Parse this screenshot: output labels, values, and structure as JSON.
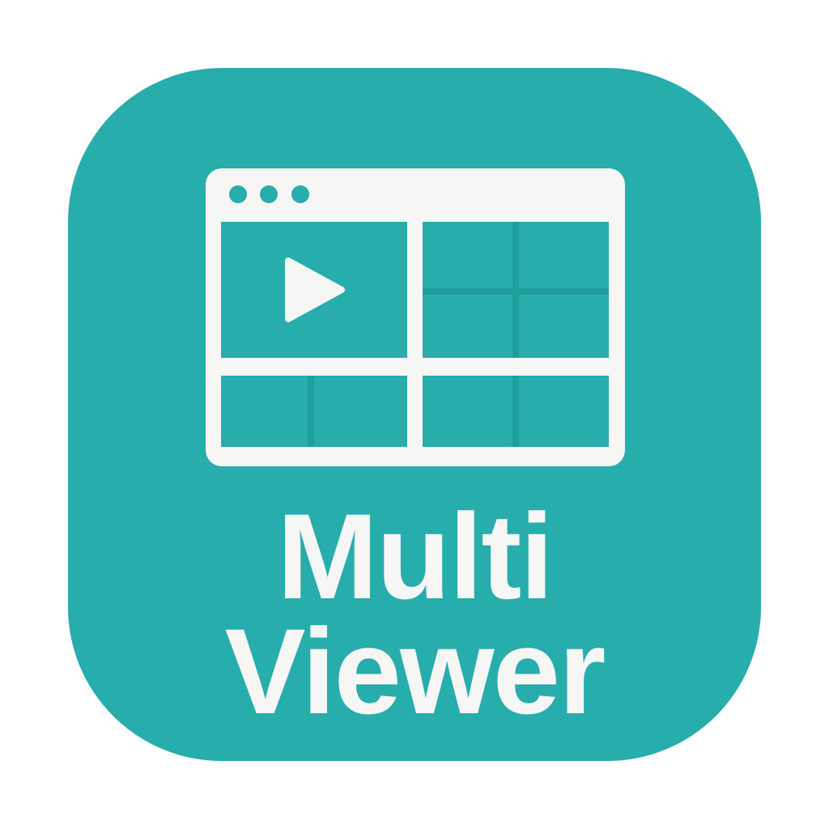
{
  "app_icon": {
    "label_lines": [
      "Multi",
      "Viewer"
    ],
    "icon_name": "multi-viewer-window-icon",
    "colors": {
      "background": "#27ADAC",
      "foreground": "#F6F6F4",
      "tile_line": "#1E9E9C"
    }
  }
}
